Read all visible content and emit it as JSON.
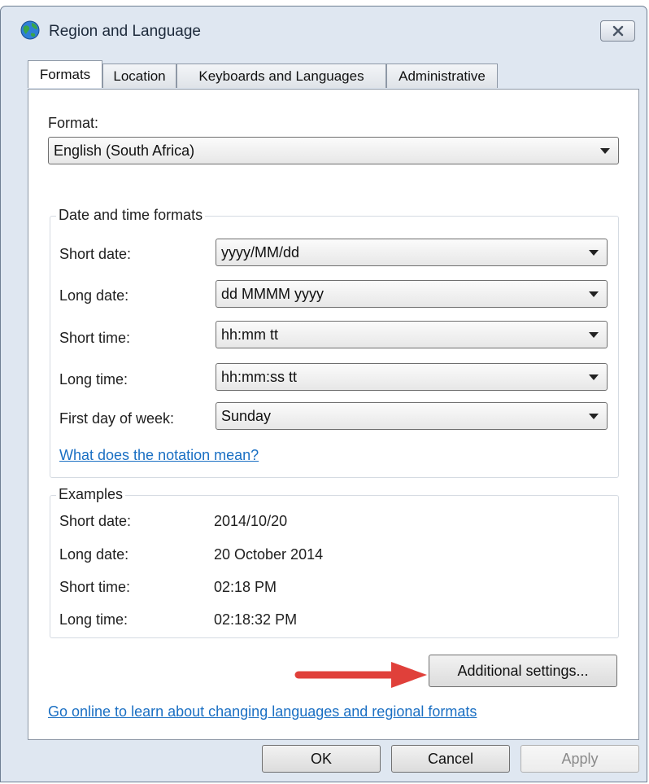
{
  "window": {
    "title": "Region and Language",
    "icon": "globe-icon",
    "close_icon": "close-icon"
  },
  "tabs": [
    {
      "label": "Formats",
      "active": true
    },
    {
      "label": "Location",
      "active": false
    },
    {
      "label": "Keyboards and Languages",
      "active": false
    },
    {
      "label": "Administrative",
      "active": false
    }
  ],
  "format": {
    "label": "Format:",
    "value": "English (South Africa)"
  },
  "date_time_formats": {
    "title": "Date and time formats",
    "rows": [
      {
        "label": "Short date:",
        "value": "yyyy/MM/dd"
      },
      {
        "label": "Long date:",
        "value": "dd MMMM yyyy"
      },
      {
        "label": "Short time:",
        "value": "hh:mm tt"
      },
      {
        "label": "Long time:",
        "value": "hh:mm:ss tt"
      },
      {
        "label": "First day of week:",
        "value": "Sunday"
      }
    ],
    "notation_link": "What does the notation mean?"
  },
  "examples": {
    "title": "Examples",
    "rows": [
      {
        "label": "Short date:",
        "value": "2014/10/20"
      },
      {
        "label": "Long date:",
        "value": "20 October 2014"
      },
      {
        "label": "Short time:",
        "value": "02:18 PM"
      },
      {
        "label": "Long time:",
        "value": "02:18:32 PM"
      }
    ]
  },
  "additional_settings_label": "Additional settings...",
  "online_link": "Go online to learn about changing languages and regional formats",
  "footer": {
    "ok": "OK",
    "cancel": "Cancel",
    "apply": "Apply"
  },
  "colors": {
    "link": "#1a6fc3",
    "annotation_arrow": "#e0403a",
    "window_frame": "#dfe7f1"
  }
}
